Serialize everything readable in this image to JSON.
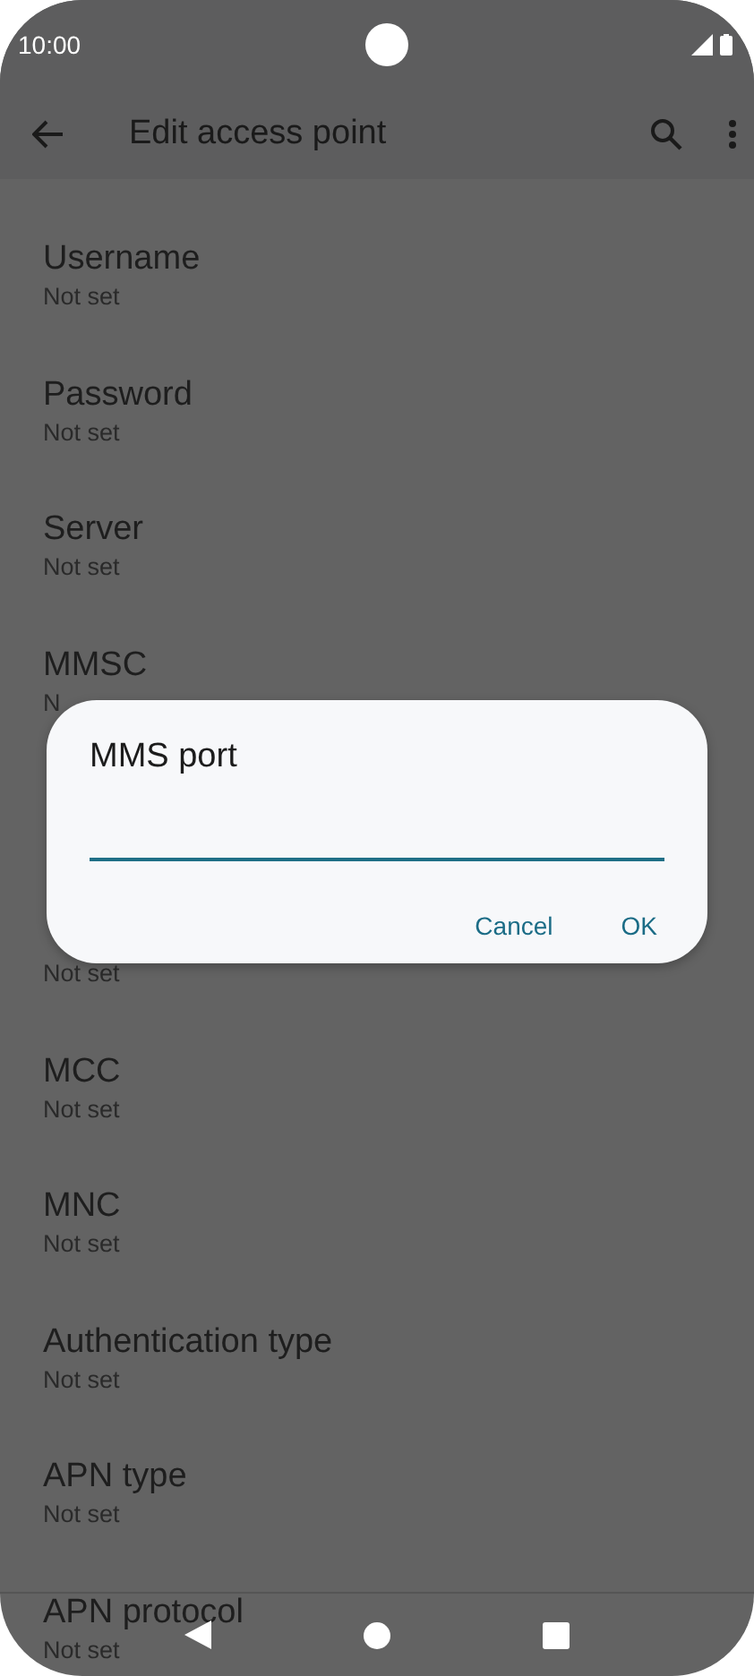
{
  "status_bar": {
    "time": "10:00"
  },
  "toolbar": {
    "title": "Edit access point"
  },
  "settings": [
    {
      "title": "Username",
      "subtitle": "Not set"
    },
    {
      "title": "Password",
      "subtitle": "Not set"
    },
    {
      "title": "Server",
      "subtitle": "Not set"
    },
    {
      "title": "MMSC",
      "subtitle": "N"
    },
    {
      "kind": "covered",
      "subtitle": "Not set"
    },
    {
      "title": "MCC",
      "subtitle": "Not set"
    },
    {
      "title": "MNC",
      "subtitle": "Not set"
    },
    {
      "title": "Authentication type",
      "subtitle": "Not set"
    },
    {
      "title": "APN type",
      "subtitle": "Not set"
    },
    {
      "title": "APN protocol",
      "subtitle": "Not set"
    }
  ],
  "dialog": {
    "title": "MMS port",
    "buttons": [
      "Cancel",
      "OK"
    ]
  }
}
